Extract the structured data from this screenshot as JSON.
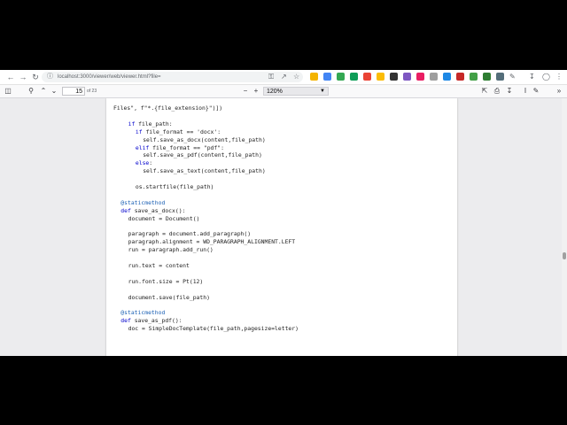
{
  "browser": {
    "url": "localhost:3000/viewer/web/viewer.html?file=",
    "back_icon": "back-arrow-icon",
    "forward_icon": "forward-arrow-icon",
    "reload_icon": "reload-icon"
  },
  "pdf_toolbar": {
    "current_page": "15",
    "page_count": "of 23",
    "zoom": "120%",
    "zoom_minus": "−",
    "zoom_plus": "+"
  },
  "code_lines": [
    {
      "t": "Files\", f\"*.{file_extension}\")])",
      "indent": 0
    },
    {
      "t": "",
      "indent": 0
    },
    {
      "t": "if file_path:",
      "indent": 4,
      "kw": "if"
    },
    {
      "t": "if file_format == 'docx':",
      "indent": 6,
      "kw": "if"
    },
    {
      "t": "self.save_as_docx(content,file_path)",
      "indent": 8
    },
    {
      "t": "elif file_format == \"pdf\":",
      "indent": 6,
      "kw": "elif"
    },
    {
      "t": "self.save_as_pdf(content,file_path)",
      "indent": 8
    },
    {
      "t": "else:",
      "indent": 6,
      "kw": "else"
    },
    {
      "t": "self.save_as_text(content,file_path)",
      "indent": 8
    },
    {
      "t": "",
      "indent": 0
    },
    {
      "t": "os.startfile(file_path)",
      "indent": 6
    },
    {
      "t": "",
      "indent": 0
    },
    {
      "t": "@staticmethod",
      "indent": 2,
      "dec": true
    },
    {
      "t": "def save_as_docx():",
      "indent": 2,
      "kw": "def"
    },
    {
      "t": "document = Document()",
      "indent": 4
    },
    {
      "t": "",
      "indent": 0
    },
    {
      "t": "paragraph = document.add_paragraph()",
      "indent": 4
    },
    {
      "t": "paragraph.alignment = WD_PARAGRAPH_ALIGNMENT.LEFT",
      "indent": 4
    },
    {
      "t": "run = paragraph.add_run()",
      "indent": 4
    },
    {
      "t": "",
      "indent": 0
    },
    {
      "t": "run.text = content",
      "indent": 4
    },
    {
      "t": "",
      "indent": 0
    },
    {
      "t": "run.font.size = Pt(12)",
      "indent": 4
    },
    {
      "t": "",
      "indent": 0
    },
    {
      "t": "document.save(file_path)",
      "indent": 4
    },
    {
      "t": "",
      "indent": 0
    },
    {
      "t": "@staticmethod",
      "indent": 2,
      "dec": true
    },
    {
      "t": "def save_as_pdf():",
      "indent": 2,
      "kw": "def"
    },
    {
      "t": "doc = SimpleDocTemplate(file_path,pagesize=letter)",
      "indent": 4
    }
  ]
}
